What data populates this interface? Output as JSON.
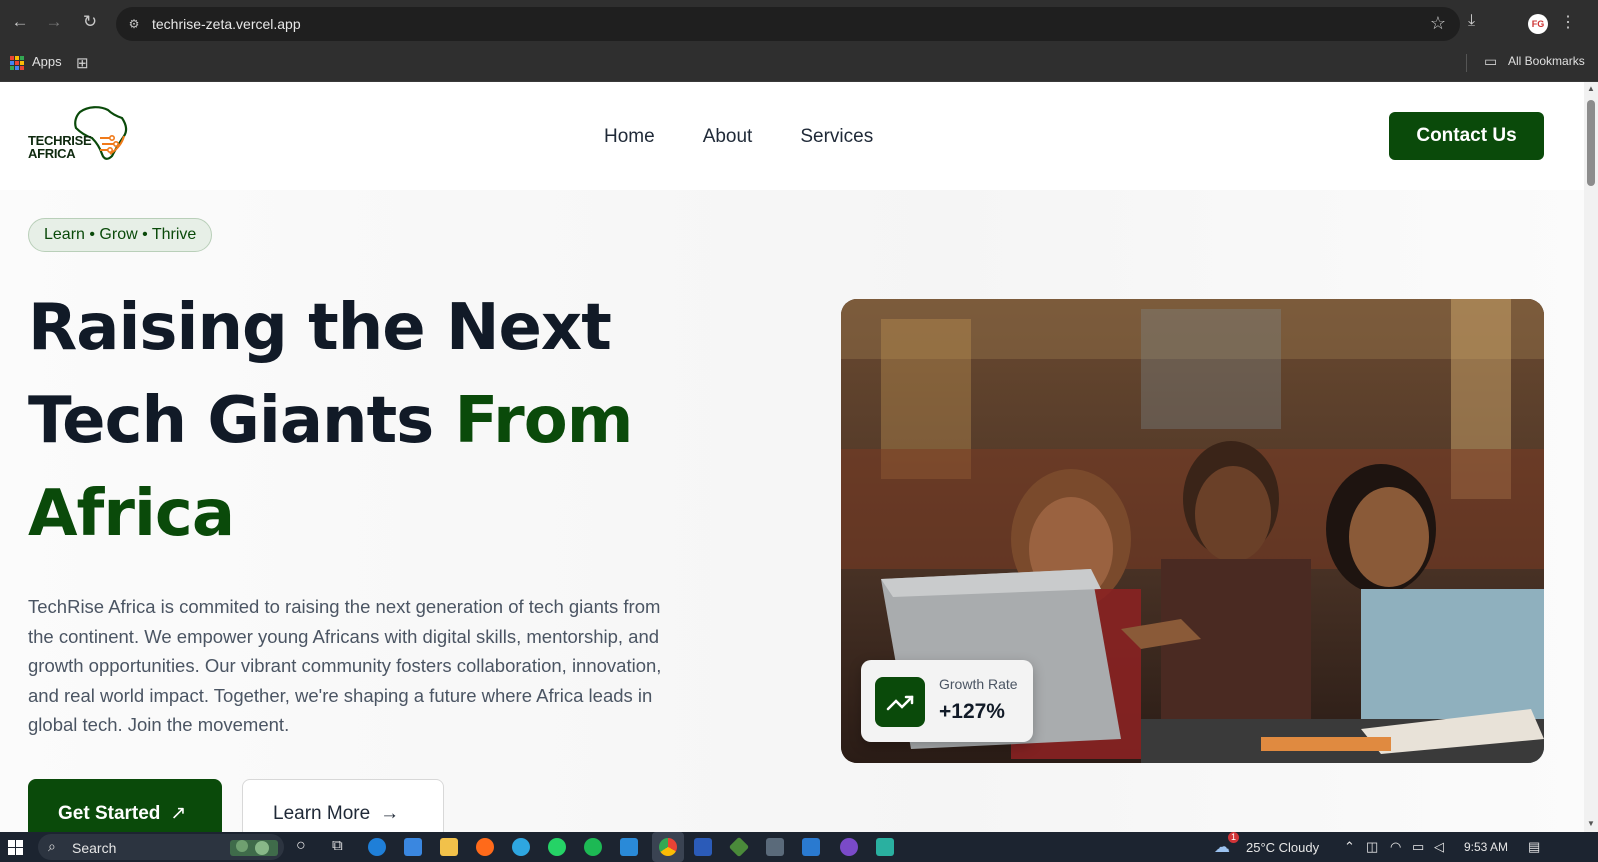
{
  "browser": {
    "url": "techrise-zeta.vercel.app",
    "bookmarks": {
      "apps_label": "Apps",
      "all_bookmarks": "All Bookmarks"
    },
    "profile_initials": "FG"
  },
  "site": {
    "logo": {
      "line1": "TECHRISE",
      "line2": "AFRICA"
    },
    "nav": [
      "Home",
      "About",
      "Services"
    ],
    "contact_label": "Contact Us",
    "colors": {
      "brand_green": "#0a4a0a",
      "logo_orange": "#f07a1a",
      "heading": "#111a27"
    }
  },
  "hero": {
    "tagline": "Learn • Grow • Thrive",
    "headline_part1": "Raising the Next Tech Giants",
    "headline_accent": "From Africa",
    "description": "TechRise Africa is commited to raising the next generation of tech giants from the continent. We empower young Africans with digital skills, mentorship, and growth opportunities. Our vibrant community fosters collaboration, innovation, and real world impact. Together, we're shaping a future where Africa leads in global tech. Join the movement.",
    "primary_button": "Get Started",
    "secondary_button": "Learn More",
    "growth_card": {
      "label": "Growth Rate",
      "value": "+127%"
    }
  },
  "taskbar": {
    "search_placeholder": "Search",
    "weather": "25°C  Cloudy",
    "weather_badge": "1",
    "time": "9:53 AM"
  }
}
